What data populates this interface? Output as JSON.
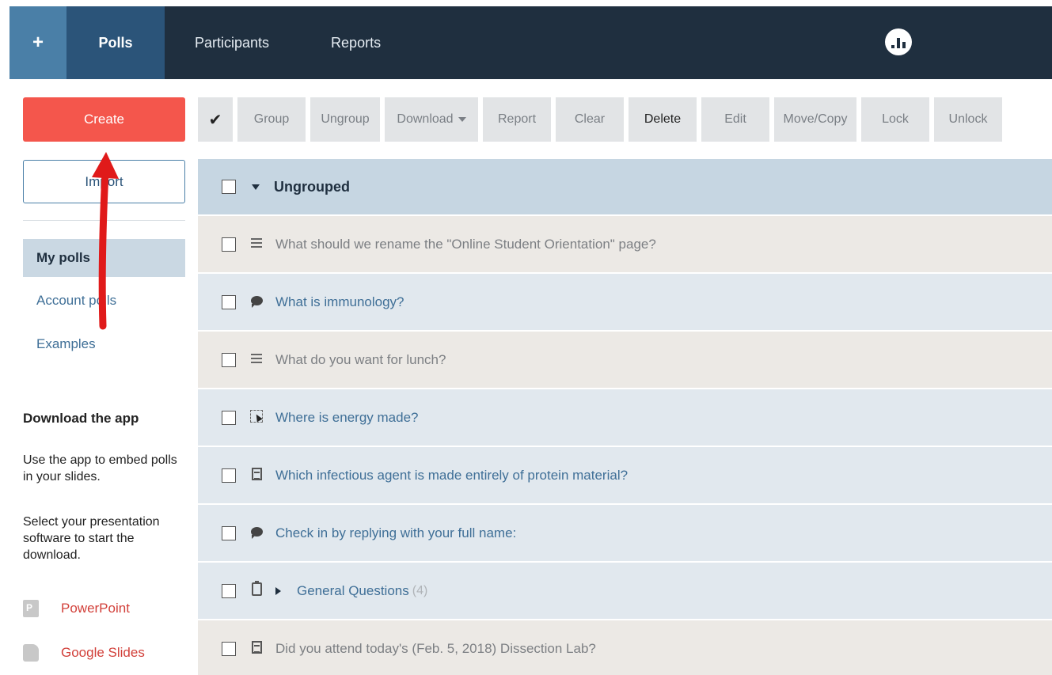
{
  "nav": {
    "plus": "+",
    "polls": "Polls",
    "participants": "Participants",
    "reports": "Reports",
    "brand_icon": "chart-logo-icon"
  },
  "sidebar": {
    "create": "Create",
    "import": "Import",
    "items": [
      {
        "label": "My polls",
        "active": true
      },
      {
        "label": "Account polls",
        "active": false
      },
      {
        "label": "Examples",
        "active": false
      }
    ],
    "download_heading": "Download the app",
    "para1": "Use the app to embed polls in your slides.",
    "para2": "Select your presentation software to start the download.",
    "downloads": [
      {
        "label": "PowerPoint",
        "icon": "powerpoint-icon"
      },
      {
        "label": "Google Slides",
        "icon": "google-slides-icon"
      }
    ]
  },
  "toolbar": {
    "check": "✔",
    "group": "Group",
    "ungroup": "Ungroup",
    "download": "Download",
    "report": "Report",
    "clear": "Clear",
    "delete": "Delete",
    "edit": "Edit",
    "move_copy": "Move/Copy",
    "lock": "Lock",
    "unlock": "Unlock"
  },
  "list": {
    "group_title": "Ungrouped",
    "rows": [
      {
        "text": "What should we rename the \"Online Student Orientation\" page?",
        "icon": "lines-icon"
      },
      {
        "text": "What is immunology?",
        "icon": "speech-bubble-icon"
      },
      {
        "text": "What do you want for lunch?",
        "icon": "lines-icon"
      },
      {
        "text": "Where is energy made?",
        "icon": "clickable-image-icon"
      },
      {
        "text": "Which infectious agent is made entirely of protein material?",
        "icon": "spreadsheet-icon"
      },
      {
        "text": "Check in by replying with your full name:",
        "icon": "speech-bubble-icon"
      },
      {
        "text": "General Questions",
        "count": "(4)",
        "icon": "clipboard-icon"
      },
      {
        "text": "Did you attend today's (Feb. 5, 2018) Dissection Lab?",
        "icon": "spreadsheet-icon"
      }
    ]
  },
  "colors": {
    "nav_bg": "#1f2f3f",
    "create_btn": "#f4564c",
    "annotation_arrow": "#e01a1a"
  }
}
